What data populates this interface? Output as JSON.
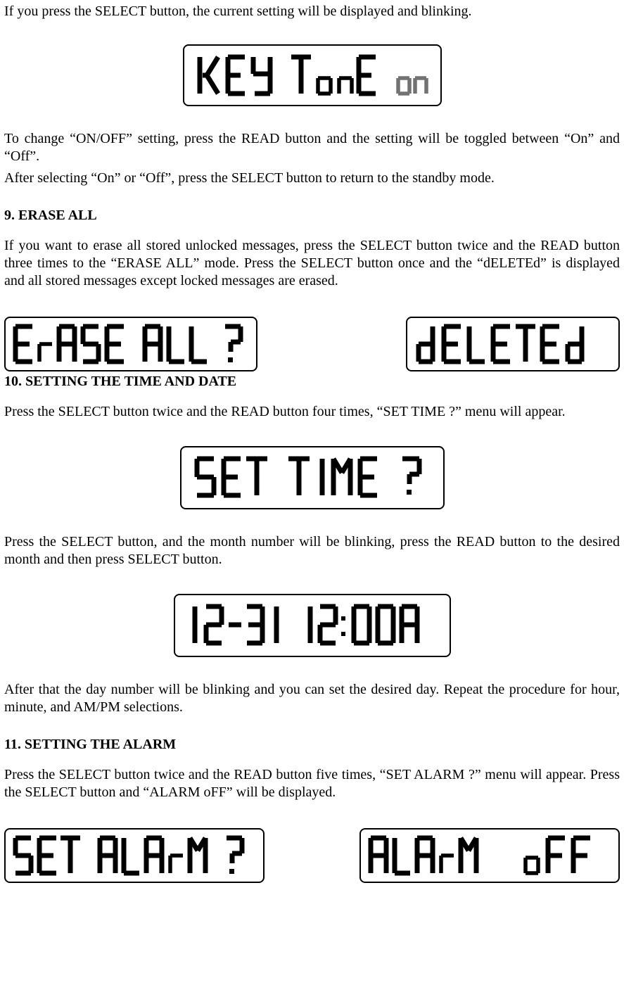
{
  "intro": {
    "p1": "If you press the SELECT button, the current setting will be displayed and blinking.",
    "p2": "To change “ON/OFF” setting, press the READ button and the setting will be toggled between “On” and “Off”.",
    "p3": "After selecting “On” or “Off”, press the SELECT button to return to the standby mode."
  },
  "section9": {
    "heading": "9. ERASE ALL",
    "p1": "If you want to erase all stored unlocked messages, press the SELECT button twice and the READ button three times to the “ERASE ALL” mode. Press the SELECT button once and the “dELETEd” is displayed and all stored messages except locked messages are erased."
  },
  "section10": {
    "heading": "10. SETTING THE TIME AND DATE",
    "p1": "Press the SELECT button twice and the READ button four times, “SET TIME ?” menu will appear.",
    "p2": "Press the SELECT button, and the month number will be blinking, press the READ button to the desired month and then press SELECT button.",
    "p3": "After that the day number will be blinking and you can set the desired day. Repeat the procedure for hour, minute, and AM/PM selections."
  },
  "section11": {
    "heading": "11. SETTING THE ALARM",
    "p1": "Press the SELECT button twice and the READ button five times, “SET ALARM ?” menu will appear. Press the SELECT button and “ALARM oFF” will be displayed."
  },
  "lcd": {
    "key_tone": "KEY TonE on",
    "erase_all": "ErASE ALL ?",
    "deleted": "dELETEd",
    "set_time": "SET TIME ?",
    "datetime": "12-31 12:00A",
    "set_alarm": "SET ALArM ?",
    "alarm_off": "ALArM  oFF"
  }
}
